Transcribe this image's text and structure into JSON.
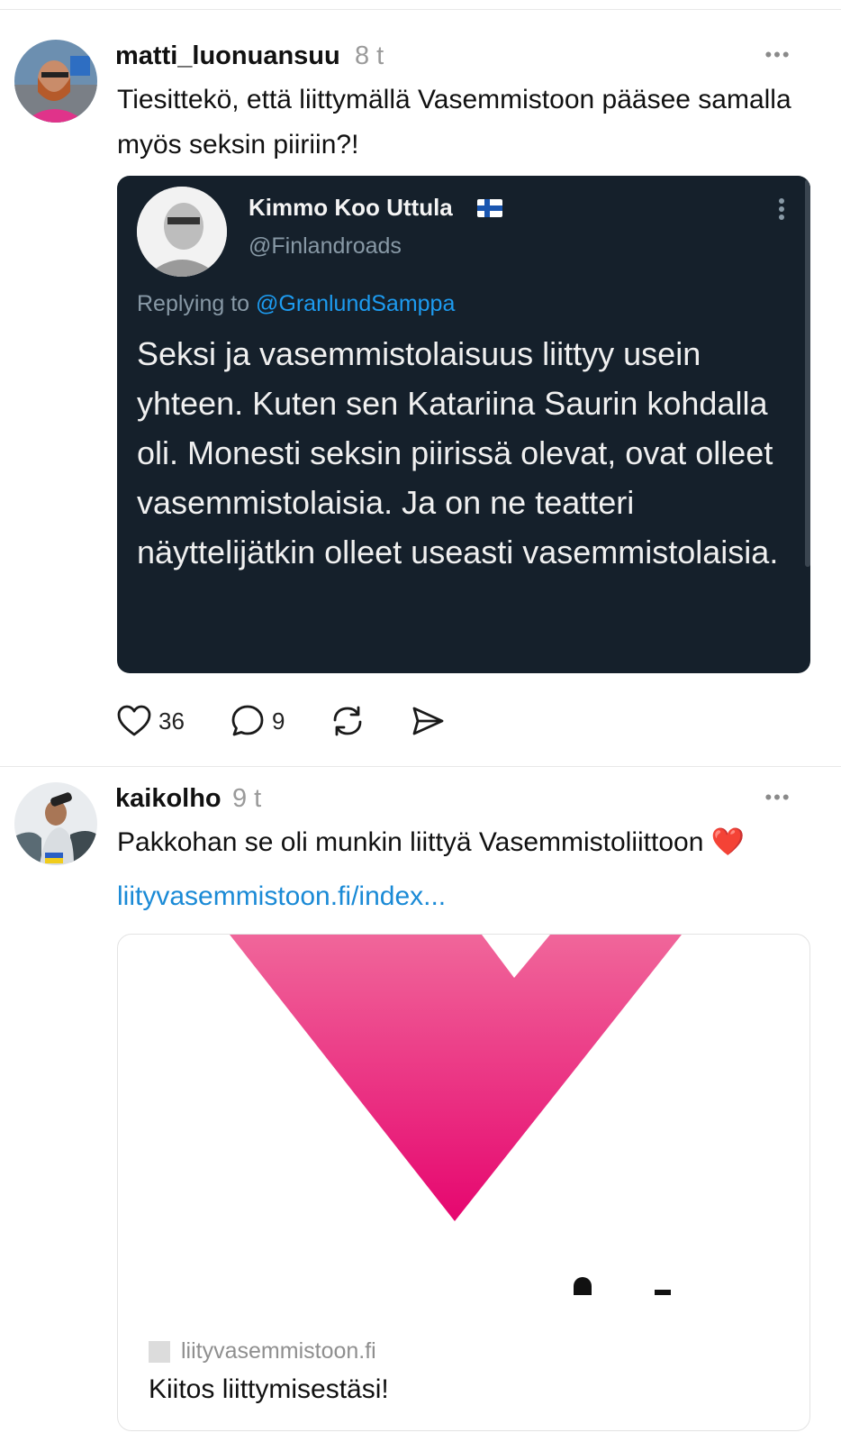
{
  "posts": [
    {
      "username": "matti_luonuansuu",
      "time": "8 t",
      "more": "•••",
      "text": "Tiesittekö, että liittymällä Vasemmistoon pääsee samalla myös seksin piiriin?!",
      "quote": {
        "name": "Kimmo Koo Uttula",
        "handle": "@Finlandroads",
        "replying_prefix": "Replying to ",
        "replying_to": "@GranlundSamppa",
        "body": "Seksi ja vasemmistolaisuus liittyy usein yhteen. Kuten sen Katariina Saurin kohdalla oli. Monesti seksin piirissä olevat, ovat olleet vasemmistolaisia. Ja on ne teatteri näyttelijätkin olleet useasti vasemmistolaisia."
      },
      "actions": {
        "likes": "36",
        "replies": "9"
      }
    },
    {
      "username": "kaikolho",
      "time": "9 t",
      "more": "•••",
      "text": "Pakkohan se oli munkin liittyä Vasemmistoliittoon ❤️",
      "link": "liityvasemmistoon.fi/index...",
      "card": {
        "domain": "liityvasemmistoon.fi",
        "title": "Kiitos liittymisestäsi!"
      }
    }
  ],
  "colors": {
    "quote_bg": "#15202b",
    "link": "#1a8ad6",
    "logo_pink_top": "#f0669a",
    "logo_pink_bottom": "#e6066f"
  }
}
